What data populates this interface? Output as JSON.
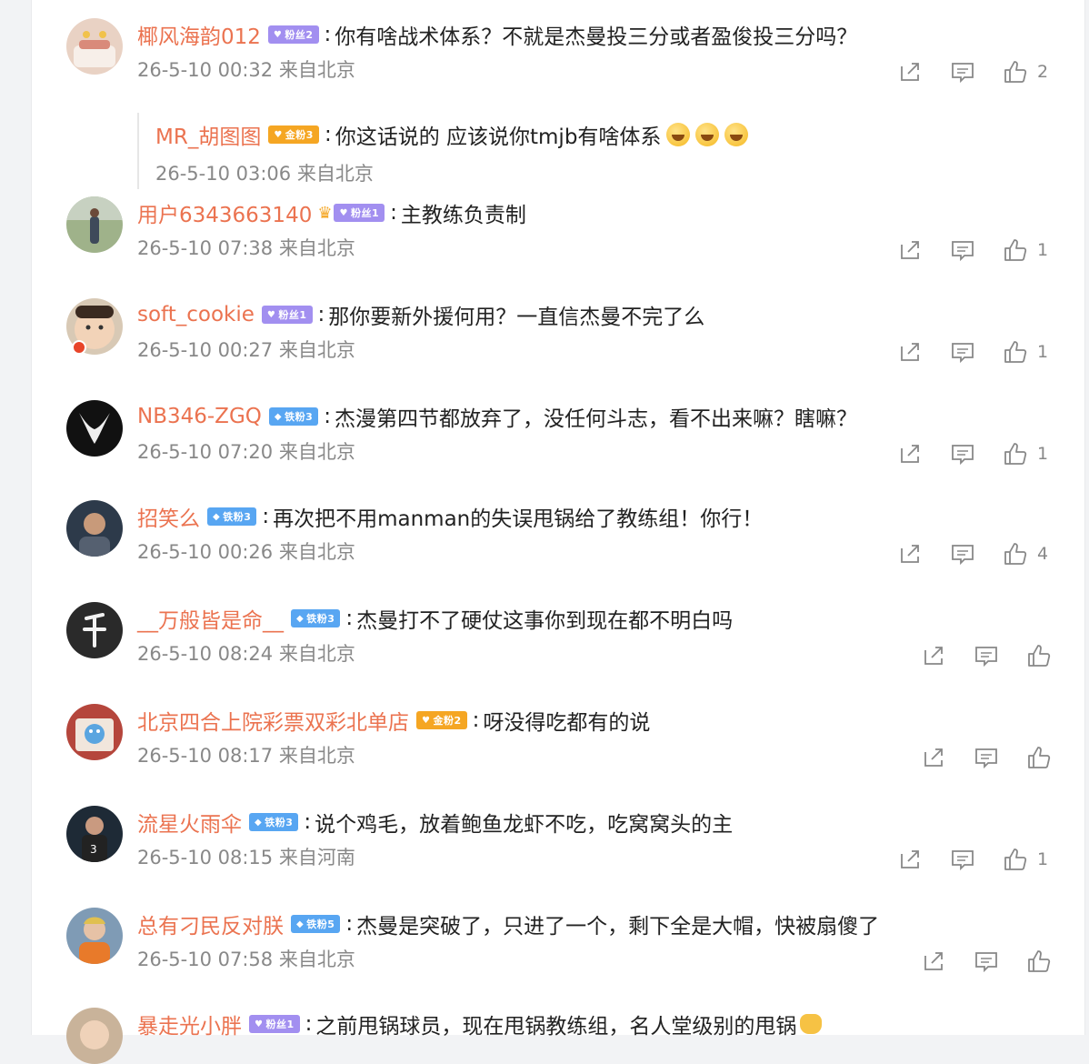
{
  "comments": [
    {
      "username": "椰风海韵012",
      "badge": "粉丝2",
      "badge_color": "purple",
      "text": "你有啥战术体系？不就是杰曼投三分或者盈俊投三分吗？",
      "meta": "26-5-10 00:32 来自北京",
      "likes": "2",
      "reply": {
        "username": "MR_胡图图",
        "badge": "金粉3",
        "badge_color": "gold",
        "text": "你这话说的 应该说你tmjb有啥体系",
        "emoji_count": 3,
        "meta": "26-5-10 03:06 来自北京"
      }
    },
    {
      "username": "用户6343663140",
      "badge": "粉丝1",
      "badge_color": "purple",
      "crown": true,
      "text": "主教练负责制",
      "meta": "26-5-10 07:38 来自北京",
      "likes": "1"
    },
    {
      "username": "soft_cookie",
      "badge": "粉丝1",
      "badge_color": "purple",
      "text": "那你要新外援何用？一直信杰曼不完了么",
      "meta": "26-5-10 00:27 来自北京",
      "likes": "1"
    },
    {
      "username": "NB346-ZGQ",
      "badge": "铁粉3",
      "badge_color": "blue",
      "text": "杰漫第四节都放弃了，没任何斗志，看不出来嘛？瞎嘛？",
      "meta": "26-5-10 07:20 来自北京",
      "likes": "1"
    },
    {
      "username": "招笑么",
      "badge": "铁粉3",
      "badge_color": "blue",
      "text": "再次把不用manman的失误甩锅给了教练组！你行！",
      "meta": "26-5-10 00:26 来自北京",
      "likes": "4"
    },
    {
      "username": "__万般皆是命__",
      "badge": "铁粉3",
      "badge_color": "blue",
      "text": "杰曼打不了硬仗这事你到现在都不明白吗",
      "meta": "26-5-10 08:24 来自北京",
      "likes": ""
    },
    {
      "username": "北京四合上院彩票双彩北单店",
      "badge": "金粉2",
      "badge_color": "gold",
      "text": "呀没得吃都有的说",
      "meta": "26-5-10 08:17 来自北京",
      "likes": ""
    },
    {
      "username": "流星火雨伞",
      "badge": "铁粉3",
      "badge_color": "blue",
      "text": "说个鸡毛，放着鲍鱼龙虾不吃，吃窝窝头的主",
      "meta": "26-5-10 08:15 来自河南",
      "likes": "1"
    },
    {
      "username": "总有刁民反对朕",
      "badge": "铁粉5",
      "badge_color": "blue",
      "text": "杰曼是突破了，只进了一个，剩下全是大帽，快被扇傻了",
      "meta": "26-5-10 07:58 来自北京",
      "likes": ""
    },
    {
      "username": "暴走光小胖",
      "badge": "粉丝1",
      "badge_color": "purple",
      "text": "之前甩锅球员，现在甩锅教练组，名人堂级别的甩锅",
      "meta": "",
      "likes": ""
    }
  ],
  "colors": {
    "username": "#eb7350",
    "text": "#222222",
    "meta": "#888888"
  },
  "icons": [
    "forward-icon",
    "comment-icon",
    "like-icon"
  ]
}
